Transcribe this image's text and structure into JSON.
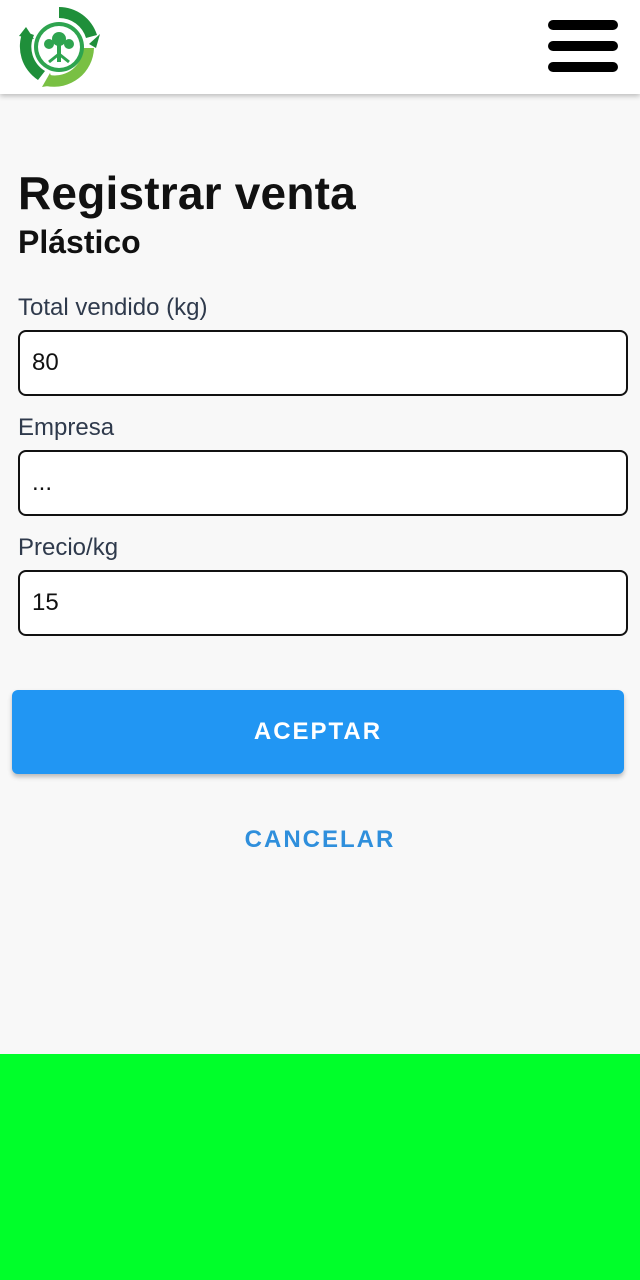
{
  "header": {
    "logo_icon": "recycling-tree-logo",
    "menu_icon": "hamburger-menu-icon"
  },
  "form": {
    "title": "Registrar venta",
    "subtitle": "Plástico",
    "fields": [
      {
        "label": "Total vendido (kg)",
        "value": "80"
      },
      {
        "label": "Empresa",
        "value": "..."
      },
      {
        "label": "Precio/kg",
        "value": "15"
      }
    ],
    "accept_label": "ACEPTAR",
    "cancel_label": "CANCELAR"
  },
  "colors": {
    "accept_button": "#2196f3",
    "cancel_text": "#2f8fdc",
    "bottom_block": "#00ff2a",
    "logo_green_dark": "#1f8f3a",
    "logo_green_light": "#79c043"
  }
}
